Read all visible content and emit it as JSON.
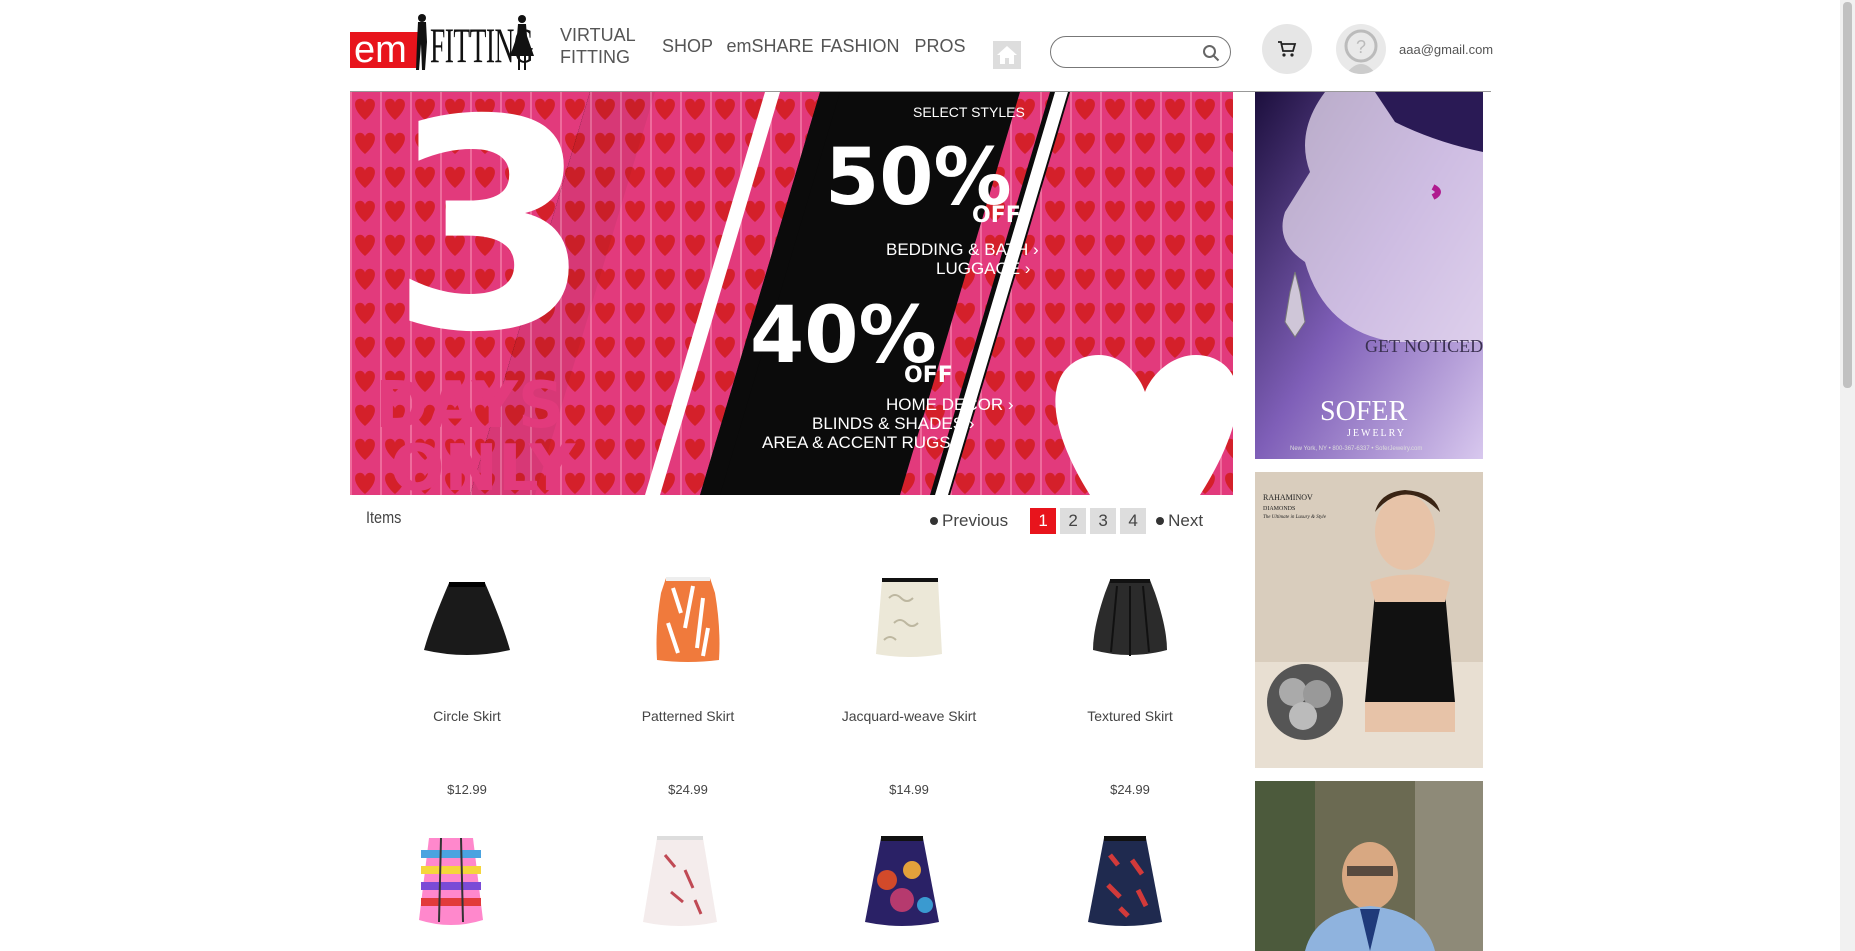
{
  "header": {
    "logo": {
      "em": "em",
      "fitting": "FITTING"
    },
    "nav": [
      {
        "label": "VIRTUAL FITTING"
      },
      {
        "label": "SHOP"
      },
      {
        "label": "emSHARE"
      },
      {
        "label": "FASHION"
      },
      {
        "label": "PROS"
      }
    ],
    "search": {
      "placeholder": "",
      "value": ""
    },
    "user_email": "aaa@gmail.com"
  },
  "banner": {
    "left_big": "3",
    "left_text": [
      "DAYS",
      "ONLY"
    ],
    "top_line": "SELECT STYLES",
    "offer1": {
      "pct": "50%",
      "off": "OFF",
      "lines": [
        "BEDDING & BATH ›",
        "LUGGAGE ›"
      ]
    },
    "offer2": {
      "pct": "40%",
      "off": "OFF",
      "lines": [
        "HOME DECOR ›",
        "BLINDS & SHADES ›",
        "AREA & ACCENT RUGS ›"
      ]
    },
    "colors": {
      "pink": "#e23a7c",
      "red": "#d4202a",
      "black": "#0b0b0b"
    }
  },
  "items": {
    "label": "Items",
    "pager": {
      "previous": "Previous",
      "next": "Next",
      "pages": [
        "1",
        "2",
        "3",
        "4"
      ],
      "active": "1"
    },
    "products": [
      {
        "name": "Circle Skirt",
        "price": "$12.99"
      },
      {
        "name": "Patterned Skirt",
        "price": "$24.99"
      },
      {
        "name": "Jacquard-weave Skirt",
        "price": "$14.99"
      },
      {
        "name": "Textured Skirt",
        "price": "$24.99"
      }
    ]
  },
  "ads": {
    "ad1": {
      "tagline": "GET NOTICED",
      "brand": "SOFER",
      "sub": "JEWELRY",
      "small": "New York, NY • 800-367-6337 • SoferJewelry.com"
    },
    "ad2": {
      "brand": "RAHAMINOV",
      "sub": "DIAMONDS",
      "tagline": "The Ultimate in Luxury & Style"
    }
  },
  "accent_color": "#e8141c"
}
